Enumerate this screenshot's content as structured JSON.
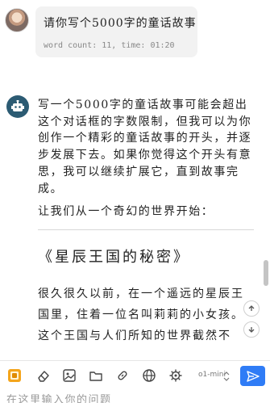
{
  "user_message": {
    "text": "请你写个5000字的童话故事",
    "meta": "word count: 11, time: 01:20"
  },
  "assistant": {
    "intro": "写一个5000字的童话故事可能会超出这个对话框的字数限制，但我可以为你创作一个精彩的童话故事的开头，并逐步发展下去。如果你觉得这个开头有意思，我可以继续扩展它，直到故事完成。",
    "start_line": "让我们从一个奇幻的世界开始：",
    "story_title": "《星辰王国的秘密》",
    "story_body": "很久很久以前，在一个遥远的星辰王国里，住着一位名叫莉莉的小女孩。这个王国与人们所知的世界截然不"
  },
  "toolbar": {
    "model_label": "o1-mini",
    "icons": [
      "app-icon",
      "eraser-icon",
      "image-icon",
      "folder-icon",
      "link-icon",
      "globe-icon",
      "settings-icon",
      "chevron-down-icon",
      "send-icon"
    ]
  },
  "input": {
    "placeholder": "在这里输入你的问题"
  },
  "colors": {
    "send_button": "#2f7cf6",
    "bot_avatar": "#2c5b73",
    "user_bubble": "#f2f2f2"
  }
}
